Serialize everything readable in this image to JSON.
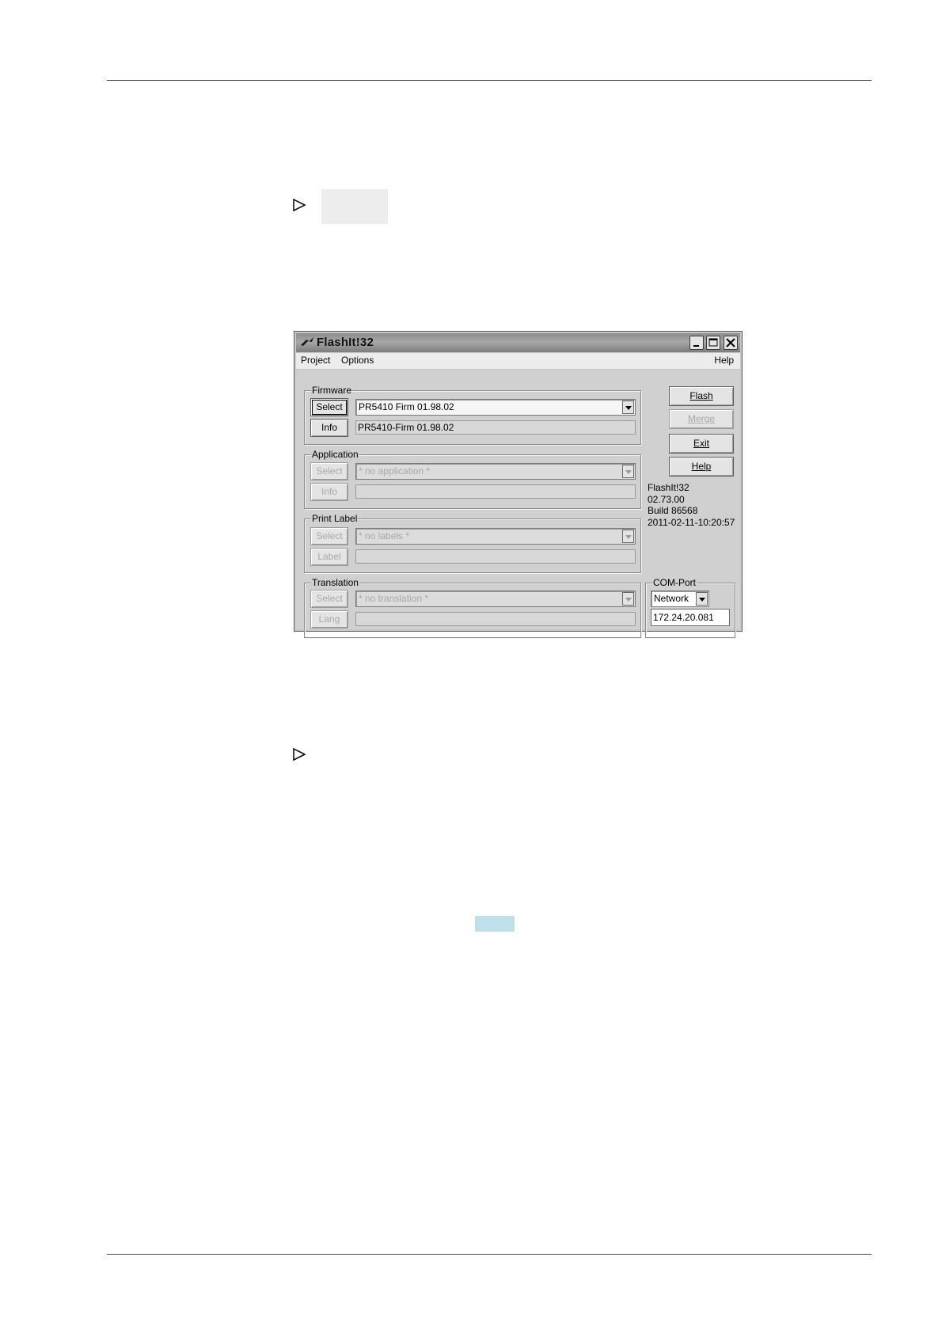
{
  "window": {
    "title": "FlashIt!32",
    "menu": {
      "project": "Project",
      "options": "Options",
      "help": "Help"
    }
  },
  "firmware": {
    "group_label": "Firmware",
    "select_label": "Select",
    "info_label": "Info",
    "combo_value": "PR5410 Firm 01.98.02",
    "info_value": "PR5410-Firm 01.98.02"
  },
  "application": {
    "group_label": "Application",
    "select_label": "Select",
    "info_label": "Info",
    "combo_value": "* no application *",
    "info_value": ""
  },
  "print_label": {
    "group_label": "Print Label",
    "select_label": "Select",
    "label_label": "Label",
    "combo_value": "* no labels *",
    "info_value": ""
  },
  "translation": {
    "group_label": "Translation",
    "select_label": "Select",
    "lang_label": "Lang",
    "combo_value": "* no translation *",
    "info_value": ""
  },
  "actions": {
    "flash": "Flash",
    "merge": "Merge",
    "exit": "Exit",
    "help": "Help"
  },
  "version_info": {
    "name": "FlashIt!32",
    "version": "02.73.00",
    "build": "Build 86568",
    "date": "2011-02-11-10:20:57"
  },
  "com_port": {
    "group_label": "COM-Port",
    "port_value": "Network",
    "address_value": "172.24.20.081"
  }
}
